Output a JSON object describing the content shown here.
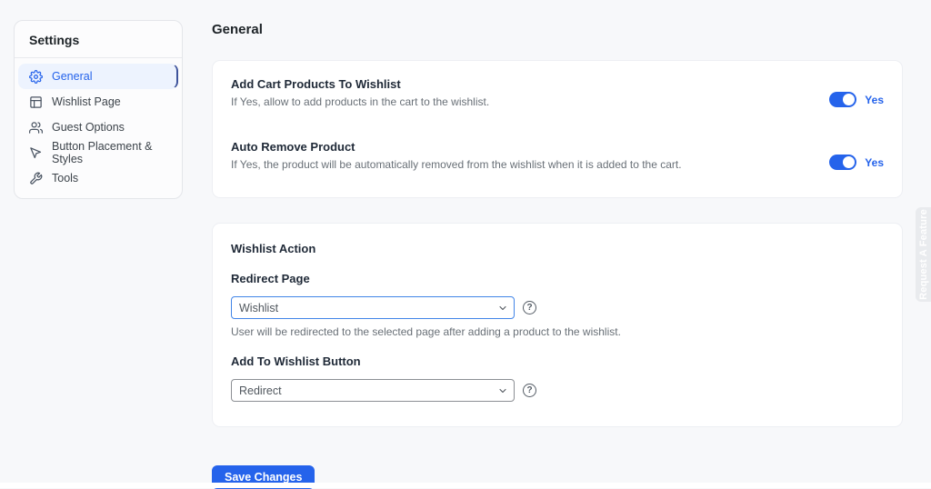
{
  "sidebar": {
    "title": "Settings",
    "items": [
      {
        "label": "General",
        "icon": "gear-icon",
        "active": true
      },
      {
        "label": "Wishlist Page",
        "icon": "layout-icon",
        "active": false
      },
      {
        "label": "Guest Options",
        "icon": "users-icon",
        "active": false
      },
      {
        "label": "Button Placement & Styles",
        "icon": "cursor-icon",
        "active": false
      },
      {
        "label": "Tools",
        "icon": "wrench-icon",
        "active": false
      }
    ]
  },
  "main": {
    "page_title": "General",
    "toggle_card": {
      "settings": [
        {
          "title": "Add Cart Products To Wishlist",
          "description": "If Yes, allow to add products in the cart to the wishlist.",
          "state": "Yes",
          "enabled": true
        },
        {
          "title": "Auto Remove Product",
          "description": "If Yes, the product will be automatically removed from the wishlist when it is added to the cart.",
          "state": "Yes",
          "enabled": true
        }
      ]
    },
    "action_card": {
      "title": "Wishlist Action",
      "fields": [
        {
          "label": "Redirect Page",
          "selected_value": "Wishlist",
          "hint": "User will be redirected to the selected page after adding a product to the wishlist.",
          "help": "?",
          "focused": true
        },
        {
          "label": "Add To Wishlist Button",
          "selected_value": "Redirect",
          "hint": "",
          "help": "?",
          "focused": false
        }
      ]
    },
    "save_button_label": "Save Changes"
  },
  "side_tab": {
    "label": "Request A Feature"
  },
  "colors": {
    "accent_blue": "#2563eb",
    "toggle_on": "#2563eb",
    "active_item_bg": "#edf3fe",
    "active_item_edge": "#3e539b",
    "page_bg": "#f7f8fa",
    "card_bg": "#ffffff"
  }
}
